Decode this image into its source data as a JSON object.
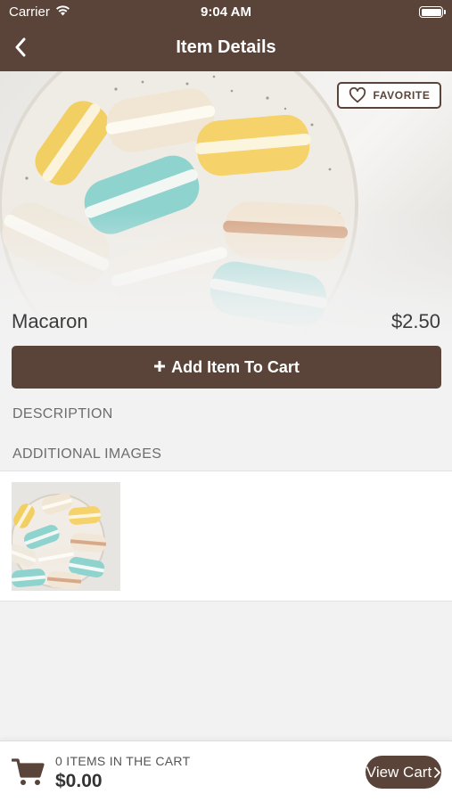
{
  "status_bar": {
    "carrier": "Carrier",
    "time": "9:04 AM"
  },
  "nav": {
    "title": "Item Details"
  },
  "favorite": {
    "label": "FAVORITE"
  },
  "item": {
    "name": "Macaron",
    "price": "$2.50"
  },
  "add_to_cart": {
    "label": "Add Item To Cart"
  },
  "sections": {
    "description": "DESCRIPTION",
    "additional_images": "ADDITIONAL IMAGES"
  },
  "cart": {
    "count_text": "0 ITEMS IN THE CART",
    "total": "$0.00",
    "view_label": "View Cart"
  },
  "colors": {
    "brand": "#5a4338",
    "background": "#f2f2f2"
  }
}
